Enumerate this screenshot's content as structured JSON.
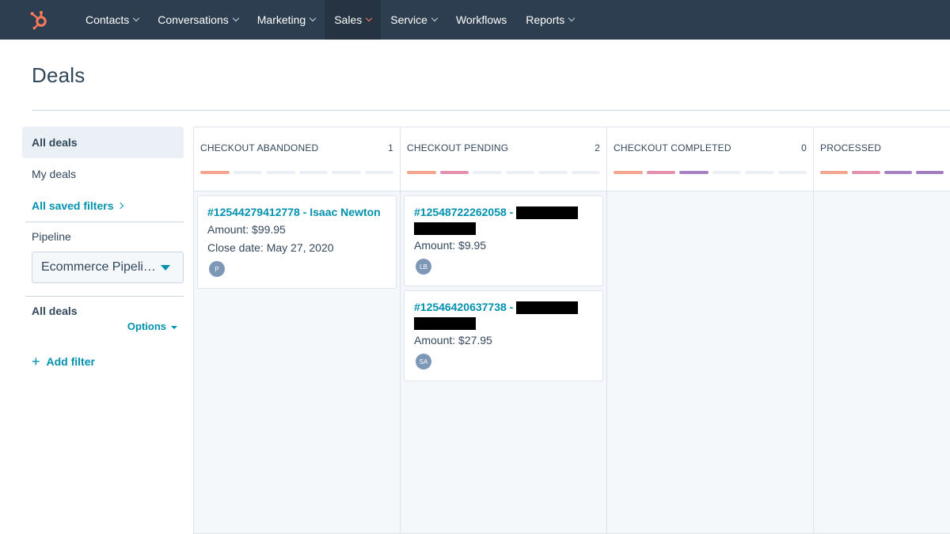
{
  "nav": {
    "items": [
      {
        "label": "Contacts"
      },
      {
        "label": "Conversations"
      },
      {
        "label": "Marketing"
      },
      {
        "label": "Sales"
      },
      {
        "label": "Service"
      },
      {
        "label": "Workflows"
      },
      {
        "label": "Reports"
      }
    ],
    "active": "Sales",
    "logo_icon": "hubspot-sprocket-icon",
    "logo_color": "#ff7a59"
  },
  "page": {
    "title": "Deals"
  },
  "sidebar": {
    "all_deals": "All deals",
    "my_deals": "My deals",
    "saved_filters": "All saved filters",
    "pipeline_label": "Pipeline",
    "pipeline_value": "Ecommerce Pipeli…",
    "filter_title": "All deals",
    "options": "Options",
    "add_filter": "Add filter"
  },
  "board": {
    "columns": [
      {
        "title": "CHECKOUT ABANDONED",
        "count": "1",
        "cards": [
          {
            "title": "#12544279412778 - Isaac Newton",
            "amount": "Amount: $99.95",
            "close": "Close date: May 27, 2020",
            "avatar": "P"
          }
        ]
      },
      {
        "title": "CHECKOUT PENDING",
        "count": "2",
        "cards": [
          {
            "title": "#12548722262058 -",
            "amount": "Amount: $9.95",
            "avatar": "LB"
          },
          {
            "title": "#12546420637738 -",
            "amount": "Amount: $27.95",
            "avatar": "SA"
          }
        ]
      },
      {
        "title": "CHECKOUT COMPLETED",
        "count": "0",
        "cards": []
      },
      {
        "title": "PROCESSED",
        "count": "",
        "cards": []
      }
    ],
    "stage_colors": [
      "#f2a68e",
      "#e48fae",
      "#a782c3",
      "#a07cbd"
    ],
    "empty_segment_color": "#eaf0f6"
  }
}
